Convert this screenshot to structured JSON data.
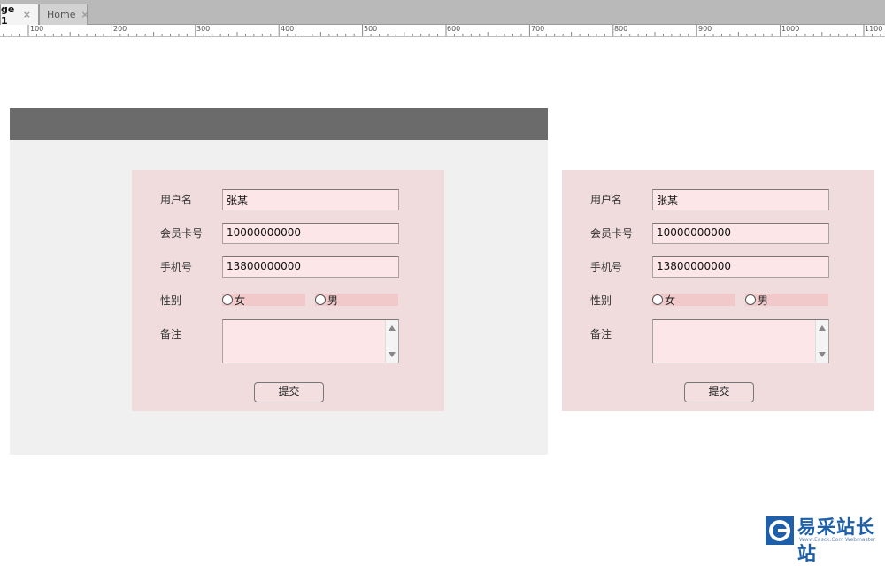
{
  "tabs": [
    {
      "label": "ge 1",
      "close": "×",
      "active": true
    },
    {
      "label": "Home",
      "close": "×",
      "active": false
    }
  ],
  "ruler": {
    "labels": [
      "100",
      "200",
      "300",
      "400",
      "500",
      "600",
      "700",
      "800",
      "900",
      "1000",
      "1100"
    ]
  },
  "form_left": {
    "username_label": "用户名",
    "username_value": "张某",
    "card_label": "会员卡号",
    "card_value": "10000000000",
    "phone_label": "手机号",
    "phone_value": "13800000000",
    "gender_label": "性别",
    "gender_female": "女",
    "gender_male": "男",
    "notes_label": "备注",
    "submit_label": "提交"
  },
  "form_right": {
    "username_label": "用户名",
    "username_value": "张某",
    "card_label": "会员卡号",
    "card_value": "10000000000",
    "phone_label": "手机号",
    "phone_value": "13800000000",
    "gender_label": "性别",
    "gender_female": "女",
    "gender_male": "男",
    "notes_label": "备注",
    "submit_label": "提交"
  },
  "watermark": {
    "title": "易采站长站",
    "sub": "Www.Easck.Com Webmaster"
  },
  "colors": {
    "page_header": "#6b6b6b",
    "page_bg": "#f0f0f0",
    "panel_bg": "#f0dcdd",
    "field_bg": "#fce6e7",
    "radio_bg": "#f1c9cb",
    "logo_blue": "#1d5fa8"
  }
}
